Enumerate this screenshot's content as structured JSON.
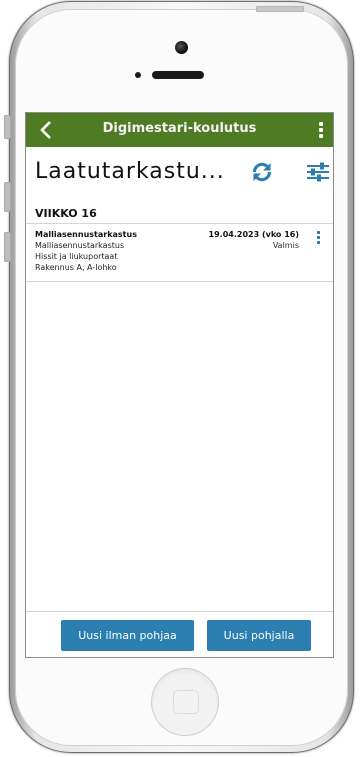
{
  "app_bar": {
    "title": "Digimestari-koulutus",
    "back_icon": "chevron-left-icon",
    "menu_icon": "kebab-menu-icon",
    "color": "#4f7b24"
  },
  "page": {
    "title": "Laatutarkastu...",
    "refresh_icon": "refresh-icon",
    "filter_icon": "filter-sliders-icon",
    "accent_color": "#2a7fb0"
  },
  "section": {
    "header": "VIIKKO 16"
  },
  "items": [
    {
      "title": "Malliasennustarkastus",
      "subtitle": "Malliasennustarkastus",
      "category": "Hissit ja liukuportaat",
      "location": "Rakennus A, A-lohko",
      "date": "19.04.2023 (vko 16)",
      "status": "Valmis"
    }
  ],
  "buttons": {
    "new_empty": "Uusi ilman pohjaa",
    "new_template": "Uusi pohjalla"
  }
}
